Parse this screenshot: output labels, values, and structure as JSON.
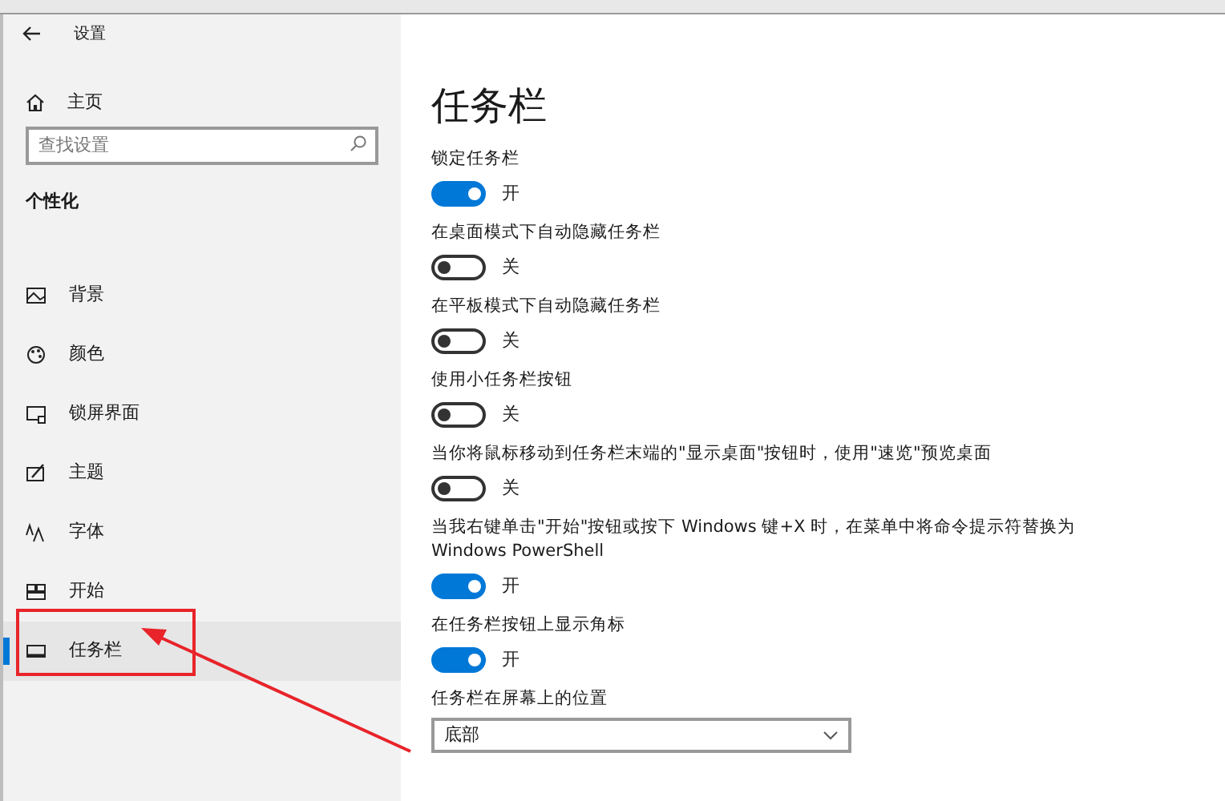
{
  "window": {
    "title": "设置"
  },
  "sidebar": {
    "home": "主页",
    "search": {
      "placeholder": "查找设置"
    },
    "section": "个性化",
    "items": [
      {
        "label": "背景",
        "selected": false
      },
      {
        "label": "颜色",
        "selected": false
      },
      {
        "label": "锁屏界面",
        "selected": false
      },
      {
        "label": "主题",
        "selected": false
      },
      {
        "label": "字体",
        "selected": false
      },
      {
        "label": "开始",
        "selected": false
      },
      {
        "label": "任务栏",
        "selected": true
      }
    ]
  },
  "page": {
    "title": "任务栏",
    "settings": [
      {
        "kind": "toggle",
        "label": "锁定任务栏",
        "on": true,
        "state_text": "开"
      },
      {
        "kind": "toggle",
        "label": "在桌面模式下自动隐藏任务栏",
        "on": false,
        "state_text": "关"
      },
      {
        "kind": "toggle",
        "label": "在平板模式下自动隐藏任务栏",
        "on": false,
        "state_text": "关"
      },
      {
        "kind": "toggle",
        "label": "使用小任务栏按钮",
        "on": false,
        "state_text": "关"
      },
      {
        "kind": "toggle",
        "label": "当你将鼠标移动到任务栏末端的\"显示桌面\"按钮时，使用\"速览\"预览桌面",
        "on": false,
        "state_text": "关"
      },
      {
        "kind": "toggle",
        "label": "当我右键单击\"开始\"按钮或按下 Windows 键+X 时，在菜单中将命令提示符替换为 Windows PowerShell",
        "on": true,
        "state_text": "开"
      },
      {
        "kind": "toggle",
        "label": "在任务栏按钮上显示角标",
        "on": true,
        "state_text": "开"
      },
      {
        "kind": "dropdown",
        "label": "任务栏在屏幕上的位置",
        "value": "底部"
      }
    ]
  }
}
